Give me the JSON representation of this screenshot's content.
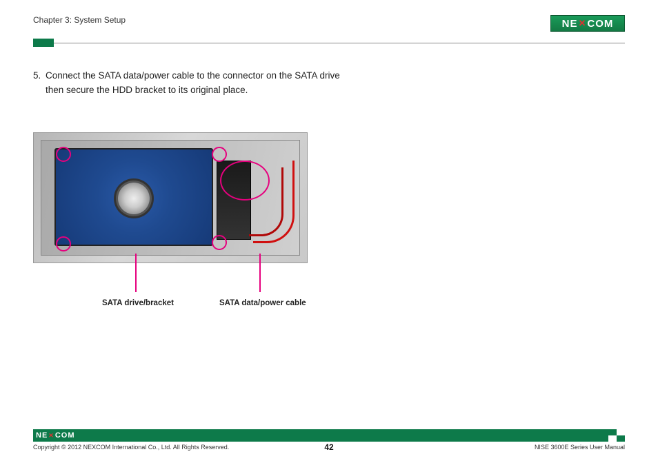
{
  "header": {
    "chapter": "Chapter 3: System Setup",
    "brand": "NEXCOM"
  },
  "step": {
    "number": "5.",
    "text": "Connect the SATA data/power cable to the connector on the SATA drive then secure the HDD bracket to its original place."
  },
  "figure": {
    "labels": {
      "drive_bracket": "SATA drive/bracket",
      "data_power_cable": "SATA data/power cable"
    }
  },
  "footer": {
    "brand": "NEXCOM",
    "copyright": "Copyright © 2012 NEXCOM International Co., Ltd. All Rights Reserved.",
    "page_number": "42",
    "manual": "NISE 3600E Series User Manual"
  }
}
